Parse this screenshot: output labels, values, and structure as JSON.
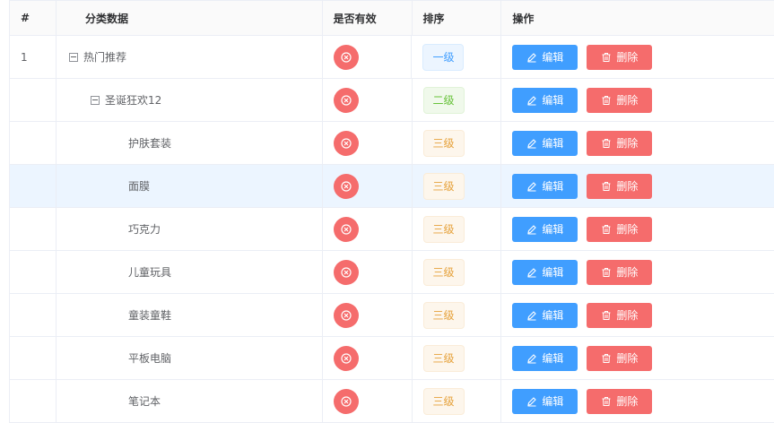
{
  "headers": {
    "index": "#",
    "name": "分类数据",
    "valid": "是否有效",
    "order": "排序",
    "actions": "操作"
  },
  "rows": [
    {
      "index": "1",
      "name": "热门推荐",
      "level": 1,
      "order": "一级",
      "valid_icon": "close-circle-icon",
      "expandable": true
    },
    {
      "index": "",
      "name": "圣诞狂欢12",
      "level": 2,
      "order": "二级",
      "valid_icon": "close-circle-icon",
      "expandable": true
    },
    {
      "index": "",
      "name": "护肤套装",
      "level": 3,
      "order": "三级",
      "valid_icon": "close-circle-icon",
      "expandable": false
    },
    {
      "index": "",
      "name": "面膜",
      "level": 3,
      "order": "三级",
      "valid_icon": "close-circle-icon",
      "expandable": false,
      "highlighted": true
    },
    {
      "index": "",
      "name": "巧克力",
      "level": 3,
      "order": "三级",
      "valid_icon": "close-circle-icon",
      "expandable": false
    },
    {
      "index": "",
      "name": "儿童玩具",
      "level": 3,
      "order": "三级",
      "valid_icon": "close-circle-icon",
      "expandable": false
    },
    {
      "index": "",
      "name": "童装童鞋",
      "level": 3,
      "order": "三级",
      "valid_icon": "close-circle-icon",
      "expandable": false
    },
    {
      "index": "",
      "name": "平板电脑",
      "level": 3,
      "order": "三级",
      "valid_icon": "close-circle-icon",
      "expandable": false
    },
    {
      "index": "",
      "name": "笔记本",
      "level": 3,
      "order": "三级",
      "valid_icon": "close-circle-icon",
      "expandable": false
    }
  ],
  "actions": {
    "edit_label": "编辑",
    "delete_label": "删除",
    "edit_icon": "edit-icon",
    "delete_icon": "trash-icon"
  },
  "colors": {
    "primary": "#409eff",
    "danger": "#f56c6c",
    "success": "#67c23a",
    "warning": "#e6a23c",
    "row_highlight": "#ecf5ff"
  }
}
